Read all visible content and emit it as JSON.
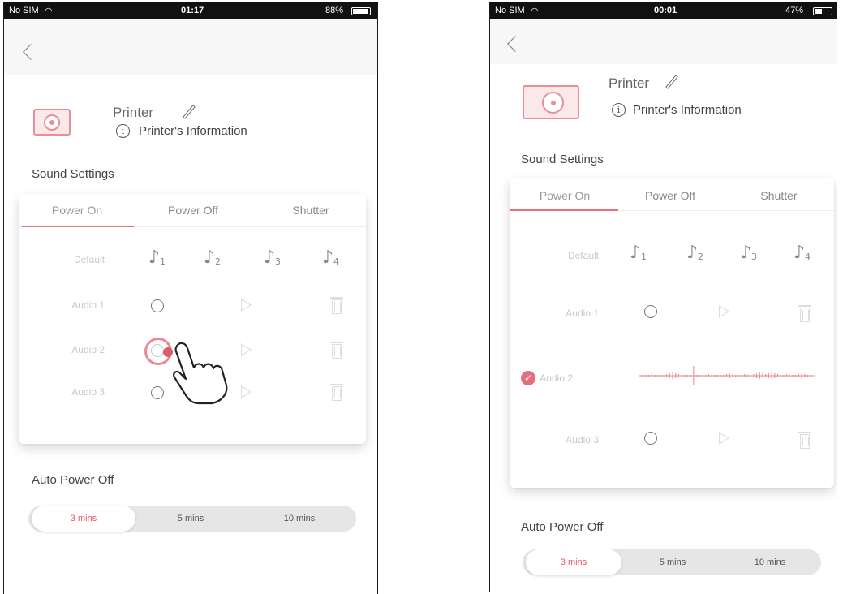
{
  "left_screen": {
    "status": {
      "carrier": "No SIM",
      "time": "01:17",
      "battery": "88%",
      "battery_level": 0.88
    },
    "printer": {
      "name": "Printer",
      "info_link": "Printer's Information"
    },
    "sound_settings": {
      "title": "Sound Settings",
      "tabs": [
        "Power On",
        "Power Off",
        "Shutter"
      ],
      "active_tab": "Power On",
      "default_label": "Default",
      "tones": [
        {
          "icon": "♪",
          "num": "1"
        },
        {
          "icon": "♪",
          "num": "2"
        },
        {
          "icon": "♪",
          "num": "3"
        },
        {
          "icon": "♪",
          "num": "4"
        }
      ],
      "rows": [
        "Audio 1",
        "Audio 2",
        "Audio 3"
      ],
      "tapped_row": "Audio 2"
    },
    "auto_power_off": {
      "title": "Auto Power Off",
      "options": [
        "3 mins",
        "5 mins",
        "10 mins"
      ],
      "selected": "3 mins"
    }
  },
  "right_screen": {
    "status": {
      "carrier": "No SIM",
      "time": "00:01",
      "battery": "47%",
      "battery_level": 0.47
    },
    "printer": {
      "name": "Printer",
      "info_link": "Printer's Information"
    },
    "sound_settings": {
      "title": "Sound Settings",
      "tabs": [
        "Power On",
        "Power Off",
        "Shutter"
      ],
      "active_tab": "Power On",
      "default_label": "Default",
      "tones": [
        {
          "icon": "♪",
          "num": "1"
        },
        {
          "icon": "♪",
          "num": "2"
        },
        {
          "icon": "♪",
          "num": "3"
        },
        {
          "icon": "♪",
          "num": "4"
        }
      ],
      "rows": [
        "Audio 1",
        "Audio 2",
        "Audio 3"
      ],
      "selected_row": "Audio 2",
      "check_glyph": "✓"
    },
    "auto_power_off": {
      "title": "Auto Power Off",
      "options": [
        "3 mins",
        "5 mins",
        "10 mins"
      ],
      "selected": "3 mins"
    }
  },
  "colors": {
    "accent": "#e4727d",
    "printer_icon": "#e88f95",
    "segment_bg": "#e6e6e6"
  }
}
